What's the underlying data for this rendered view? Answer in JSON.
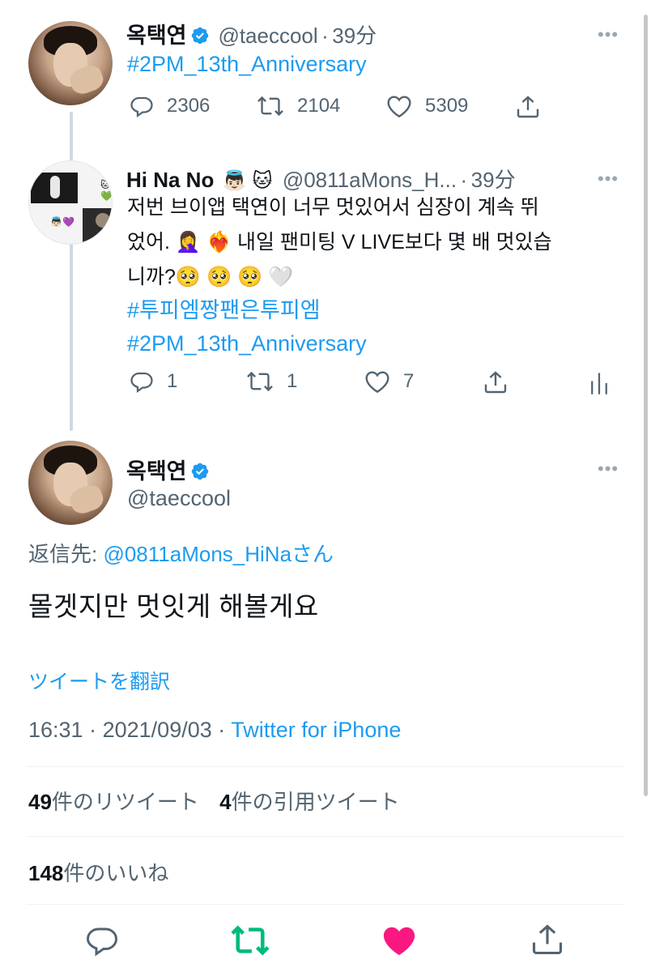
{
  "tweet1": {
    "name": "옥택연",
    "handle": "@taeccool",
    "sep": "·",
    "time": "39分",
    "hashtag": "#2PM_13th_Anniversary",
    "replies": "2306",
    "retweets": "2104",
    "likes": "5309"
  },
  "tweet2": {
    "name": "Hi Na No",
    "name_emoji": "👼🏻 🐱",
    "handle": "@0811aMons_H...",
    "sep": "·",
    "time": "39分",
    "line1": "저번 브이앱 택연이 너무 멋있어서 심장이 계속 뛰",
    "line2": "었어. 🤦‍♀️ ❤️‍🔥 내일 팬미팅 V LIVE보다 몇 배 멋있습",
    "line3": "니까?🥺 🥺 🥺 🤍",
    "hashtag1": "#투피엠짱팬은투피엠",
    "hashtag2": "#2PM_13th_Anniversary",
    "replies": "1",
    "retweets": "1",
    "likes": "7",
    "avatar_emoji1": "🐱💚",
    "avatar_emoji2": "👼🏻💜"
  },
  "main": {
    "name": "옥택연",
    "handle": "@taeccool",
    "reply_to_prefix": "返信先: ",
    "reply_to_handle": "@0811aMons_HiNa",
    "reply_to_suffix": "さん",
    "text": "몰겟지만 멋잇게 해볼게요",
    "translate": "ツイートを翻訳",
    "time": "16:31",
    "date": "2021/09/03",
    "sep": "·",
    "source": "Twitter for iPhone",
    "retweets_num": "49",
    "retweets_label": "件のリツイート",
    "quotes_num": "4",
    "quotes_label": "件の引用ツイート",
    "likes_num": "148",
    "likes_label": "件のいいね"
  },
  "colors": {
    "accent": "#1d9bf0",
    "retweet_green": "#00ba7c",
    "like_red": "#f91880",
    "muted": "#536471"
  },
  "icons": {
    "more": "more-icon",
    "verified": "verified-badge-icon",
    "reply": "reply-icon",
    "retweet": "retweet-icon",
    "like": "heart-icon",
    "share": "share-icon",
    "analytics": "analytics-icon"
  }
}
